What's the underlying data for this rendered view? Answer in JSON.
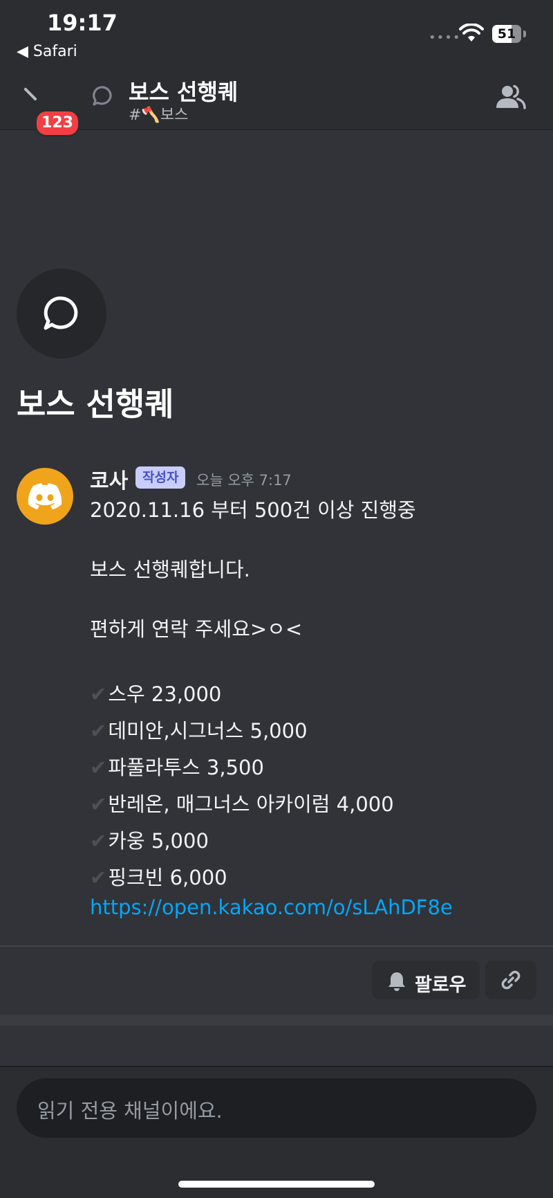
{
  "status_bar": {
    "time": "19:17",
    "back_app": "◀ Safari",
    "battery": "51"
  },
  "header": {
    "unread_badge": "123",
    "title": "보스 선행퀘",
    "channel": "#🪓보스"
  },
  "thread": {
    "title": "보스 선행퀘"
  },
  "message": {
    "author": "코사",
    "op_badge": "작성자",
    "timestamp": "오늘 오후 7:17",
    "lines": [
      "2020.11.16 부터 500건 이상 진행중",
      "보스 선행퀘합니다.",
      "편하게 연락 주세요>ㅇ<"
    ],
    "checks": [
      "스우 23,000",
      "데미안,시그너스 5,000",
      "파풀라투스 3,500",
      "반레온, 매그너스 아카이럼 4,000",
      "카웅 5,000",
      "핑크빈 6,000"
    ],
    "link": "https://open.kakao.com/o/sLAhDF8e",
    "check_mark": "✔"
  },
  "actions": {
    "follow_label": "팔로우"
  },
  "composer": {
    "readonly_text": "읽기 전용 채널이에요."
  },
  "colors": {
    "background": "#313338",
    "header": "#2b2d31",
    "badge_red": "#f23f43",
    "avatar": "#f0a41c",
    "link": "#00a8fc"
  },
  "icons": [
    "wifi-icon",
    "battery-icon",
    "back-icon",
    "thread-icon",
    "members-icon",
    "discord-logo-icon",
    "bell-icon",
    "link-icon"
  ]
}
